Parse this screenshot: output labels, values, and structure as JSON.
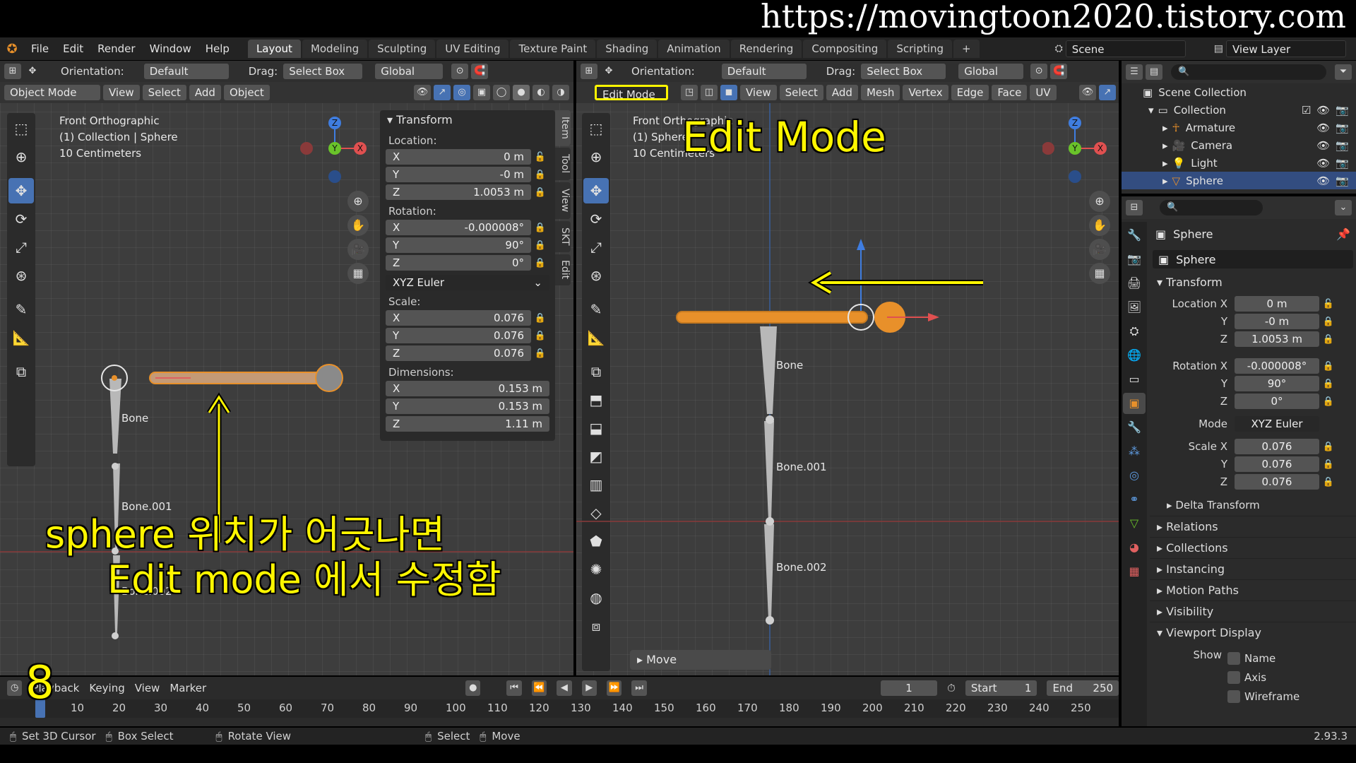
{
  "banner": {
    "url": "https://movingtoon2020.tistory.com"
  },
  "menu": [
    "File",
    "Edit",
    "Render",
    "Window",
    "Help"
  ],
  "workspaces": [
    "Layout",
    "Modeling",
    "Sculpting",
    "UV Editing",
    "Texture Paint",
    "Shading",
    "Animation",
    "Rendering",
    "Compositing",
    "Scripting"
  ],
  "scene": {
    "scene_name": "Scene",
    "view_layer": "View Layer"
  },
  "left_viewport": {
    "orientation_label": "Orientation:",
    "orientation_value": "Default",
    "drag_label": "Drag:",
    "drag_value": "Select Box",
    "transform_space": "Global",
    "mode": "Object Mode",
    "menus": [
      "View",
      "Select",
      "Add",
      "Object"
    ],
    "info": [
      "Front Orthographic",
      "(1) Collection | Sphere",
      "10 Centimeters"
    ],
    "bones": [
      "Bone",
      "Bone.001",
      "Bone.002"
    ]
  },
  "transform_panel": {
    "title": "Transform",
    "location_label": "Location:",
    "location": [
      {
        "axis": "X",
        "value": "0 m"
      },
      {
        "axis": "Y",
        "value": "-0 m"
      },
      {
        "axis": "Z",
        "value": "1.0053 m"
      }
    ],
    "rotation_label": "Rotation:",
    "rotation": [
      {
        "axis": "X",
        "value": "-0.000008°"
      },
      {
        "axis": "Y",
        "value": "90°"
      },
      {
        "axis": "Z",
        "value": "0°"
      }
    ],
    "rotation_mode": "XYZ Euler",
    "scale_label": "Scale:",
    "scale": [
      {
        "axis": "X",
        "value": "0.076"
      },
      {
        "axis": "Y",
        "value": "0.076"
      },
      {
        "axis": "Z",
        "value": "0.076"
      }
    ],
    "dimensions_label": "Dimensions:",
    "dimensions": [
      {
        "axis": "X",
        "value": "0.153 m"
      },
      {
        "axis": "Y",
        "value": "0.153 m"
      },
      {
        "axis": "Z",
        "value": "1.11 m"
      }
    ],
    "tabs": [
      "Item",
      "Tool",
      "View",
      "SKT",
      "Edit"
    ]
  },
  "right_viewport": {
    "orientation_label": "Orientation:",
    "orientation_value": "Default",
    "drag_label": "Drag:",
    "drag_value": "Select Box",
    "transform_space": "Global",
    "mode": "Edit Mode",
    "menus": [
      "View",
      "Select",
      "Add",
      "Mesh",
      "Vertex",
      "Edge",
      "Face",
      "UV"
    ],
    "info": [
      "Front Orthographic",
      "(1) Sphere",
      "10 Centimeters"
    ],
    "bones": [
      "Bone",
      "Bone.001",
      "Bone.002"
    ],
    "operator_panel": "Move"
  },
  "outliner": {
    "root": "Scene Collection",
    "collection": "Collection",
    "items": [
      "Armature",
      "Camera",
      "Light",
      "Sphere"
    ]
  },
  "properties": {
    "object_name": "Sphere",
    "data_name": "Sphere",
    "transform_title": "Transform",
    "location": [
      {
        "label": "Location X",
        "value": "0 m"
      },
      {
        "label": "Y",
        "value": "-0 m"
      },
      {
        "label": "Z",
        "value": "1.0053 m"
      }
    ],
    "rotation": [
      {
        "label": "Rotation X",
        "value": "-0.000008°"
      },
      {
        "label": "Y",
        "value": "90°"
      },
      {
        "label": "Z",
        "value": "0°"
      }
    ],
    "mode_label": "Mode",
    "mode_value": "XYZ Euler",
    "scale": [
      {
        "label": "Scale X",
        "value": "0.076"
      },
      {
        "label": "Y",
        "value": "0.076"
      },
      {
        "label": "Z",
        "value": "0.076"
      }
    ],
    "delta": "Delta Transform",
    "sections": [
      "Relations",
      "Collections",
      "Instancing",
      "Motion Paths",
      "Visibility",
      "Viewport Display"
    ],
    "show_label": "Show",
    "show_items": [
      "Name",
      "Axis",
      "Wireframe"
    ]
  },
  "timeline": {
    "menus": [
      "Playback",
      "Keying",
      "View",
      "Marker"
    ],
    "current_frame": "1",
    "start_label": "Start",
    "start_value": "1",
    "end_label": "End",
    "end_value": "250",
    "ruler": [
      "10",
      "20",
      "30",
      "40",
      "50",
      "60",
      "70",
      "80",
      "90",
      "100",
      "110",
      "120",
      "130",
      "140",
      "150",
      "160",
      "170",
      "180",
      "190",
      "200",
      "210",
      "220",
      "230",
      "240",
      "250"
    ]
  },
  "statusbar": {
    "items": [
      "Set 3D Cursor",
      "Box Select",
      "Rotate View",
      "Select",
      "Move"
    ],
    "version": "2.93.3"
  },
  "annotations": {
    "edit_mode": "Edit Mode",
    "line1": "sphere 위치가 어긋나면",
    "line2": "Edit mode 에서 수정함",
    "step": "8"
  },
  "colors": {
    "accent": "#4772b3",
    "annotation": "#fff600",
    "bone_orange": "#e8902a"
  }
}
